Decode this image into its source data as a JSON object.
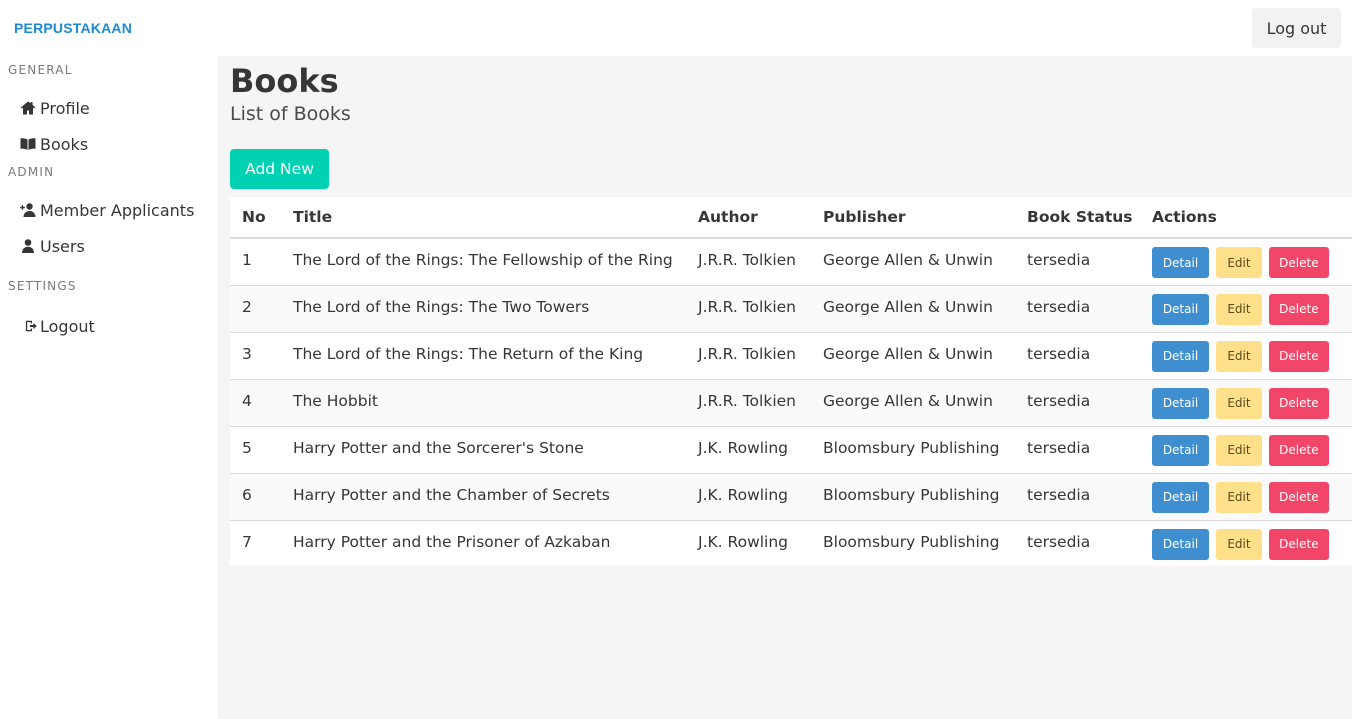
{
  "app": {
    "brand": "PERPUSTAKAAN",
    "logout_button": "Log out"
  },
  "sidebar": {
    "sections": [
      {
        "label": "GENERAL",
        "items": [
          {
            "label": "Profile",
            "icon": "home-icon"
          },
          {
            "label": "Books",
            "icon": "book-open-icon"
          }
        ]
      },
      {
        "label": "ADMIN",
        "items": [
          {
            "label": "Member Applicants",
            "icon": "user-plus-icon"
          },
          {
            "label": "Users",
            "icon": "user-icon"
          }
        ]
      },
      {
        "label": "SETTINGS",
        "items": [
          {
            "label": "Logout",
            "icon": "sign-out-icon"
          }
        ]
      }
    ]
  },
  "main": {
    "title": "Books",
    "subtitle": "List of Books",
    "add_button": "Add New",
    "table": {
      "headers": [
        "No",
        "Title",
        "Author",
        "Publisher",
        "Book Status",
        "Actions"
      ],
      "rows": [
        {
          "no": "1",
          "title": "The Lord of the Rings: The Fellowship of the Ring",
          "author": "J.R.R. Tolkien",
          "publisher": "George Allen & Unwin",
          "status": "tersedia"
        },
        {
          "no": "2",
          "title": "The Lord of the Rings: The Two Towers",
          "author": "J.R.R. Tolkien",
          "publisher": "George Allen & Unwin",
          "status": "tersedia"
        },
        {
          "no": "3",
          "title": "The Lord of the Rings: The Return of the King",
          "author": "J.R.R. Tolkien",
          "publisher": "George Allen & Unwin",
          "status": "tersedia"
        },
        {
          "no": "4",
          "title": "The Hobbit",
          "author": "J.R.R. Tolkien",
          "publisher": "George Allen & Unwin",
          "status": "tersedia"
        },
        {
          "no": "5",
          "title": "Harry Potter and the Sorcerer's Stone",
          "author": "J.K. Rowling",
          "publisher": "Bloomsbury Publishing",
          "status": "tersedia"
        },
        {
          "no": "6",
          "title": "Harry Potter and the Chamber of Secrets",
          "author": "J.K. Rowling",
          "publisher": "Bloomsbury Publishing",
          "status": "tersedia"
        },
        {
          "no": "7",
          "title": "Harry Potter and the Prisoner of Azkaban",
          "author": "J.K. Rowling",
          "publisher": "Bloomsbury Publishing",
          "status": "tersedia"
        }
      ],
      "actions": {
        "detail": "Detail",
        "edit": "Edit",
        "delete": "Delete"
      }
    }
  },
  "colors": {
    "brand": "#1d8ad1",
    "primary": "#00d1b2",
    "info": "#3e8ed0",
    "warning": "#ffe08a",
    "danger": "#f14668"
  }
}
